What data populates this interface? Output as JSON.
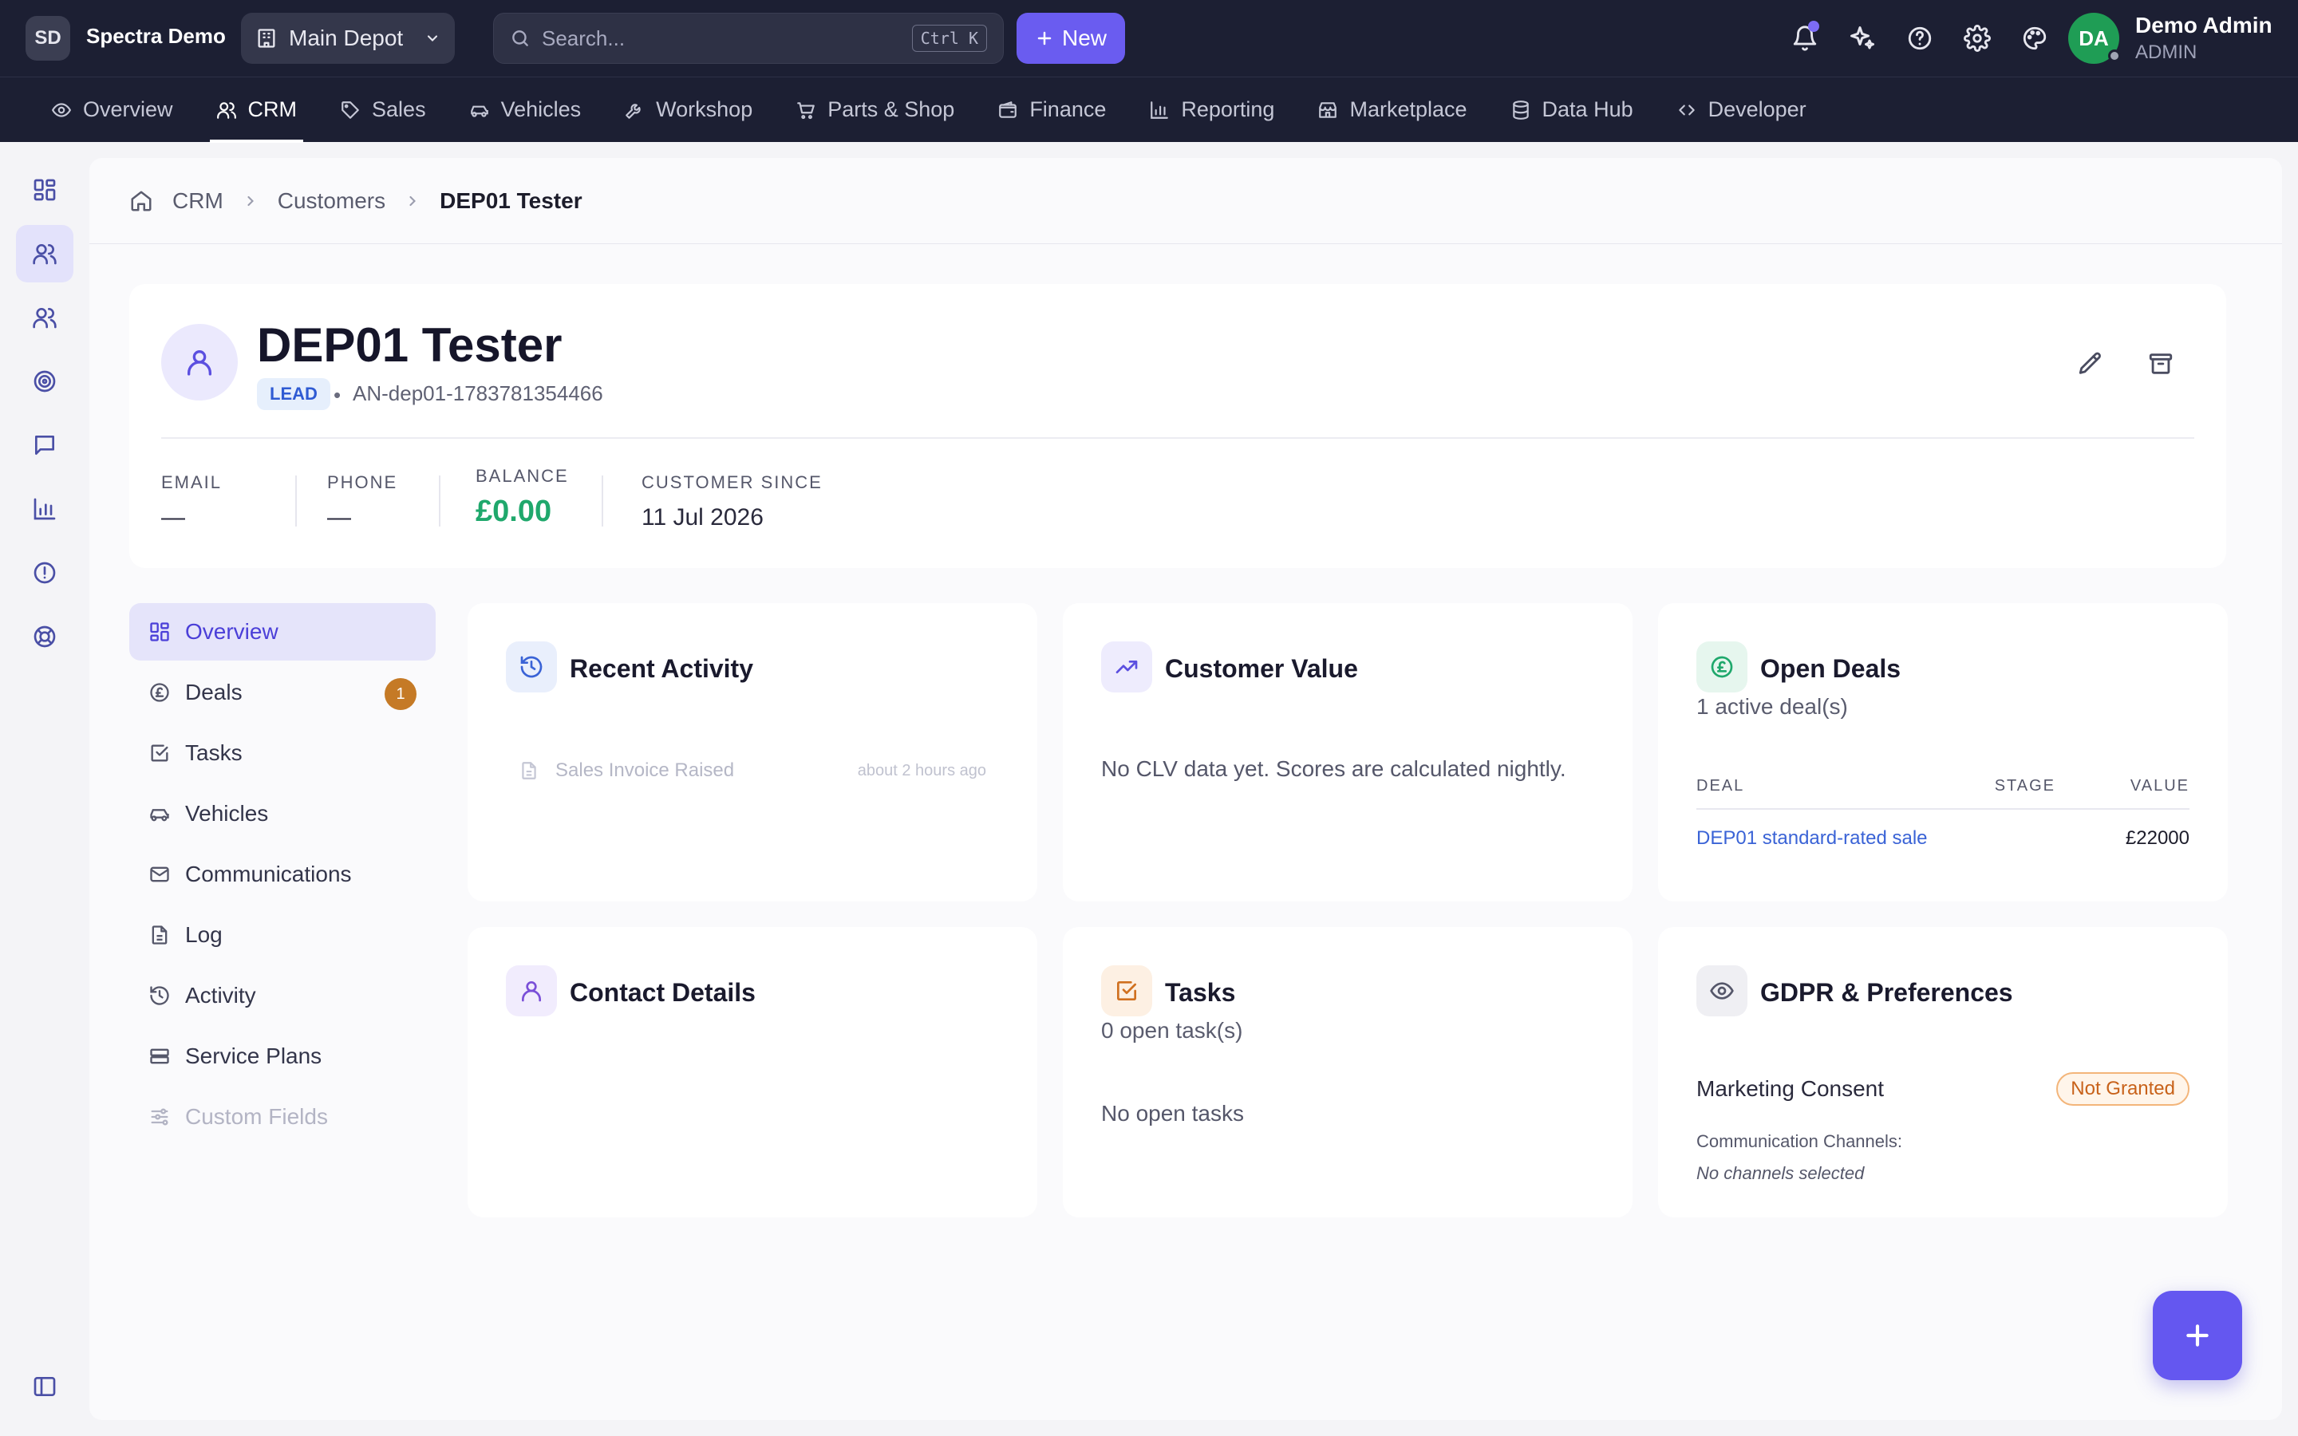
{
  "header": {
    "org_initials": "SD",
    "org_name": "Spectra Demo",
    "depot": "Main Depot",
    "search_placeholder": "Search...",
    "search_shortcut": "Ctrl K",
    "new_label": "New",
    "user_initials": "DA",
    "user_name": "Demo Admin",
    "user_role": "ADMIN"
  },
  "nav": [
    {
      "label": "Overview",
      "icon": "eye-icon"
    },
    {
      "label": "CRM",
      "icon": "users-icon"
    },
    {
      "label": "Sales",
      "icon": "tag-icon"
    },
    {
      "label": "Vehicles",
      "icon": "car-icon"
    },
    {
      "label": "Workshop",
      "icon": "wrench-icon"
    },
    {
      "label": "Parts & Shop",
      "icon": "cart-icon"
    },
    {
      "label": "Finance",
      "icon": "wallet-icon"
    },
    {
      "label": "Reporting",
      "icon": "bar-chart-icon"
    },
    {
      "label": "Marketplace",
      "icon": "store-icon"
    },
    {
      "label": "Data Hub",
      "icon": "database-icon"
    },
    {
      "label": "Developer",
      "icon": "code-icon"
    }
  ],
  "breadcrumb": {
    "root": "CRM",
    "section": "Customers",
    "current": "DEP01 Tester"
  },
  "customer": {
    "name": "DEP01 Tester",
    "status": "LEAD",
    "separator": "•",
    "account_number": "AN-dep01-1783781354466",
    "email_label": "EMAIL",
    "email_value": "—",
    "phone_label": "PHONE",
    "phone_value": "—",
    "balance_label": "BALANCE",
    "balance_value": "£0.00",
    "since_label": "CUSTOMER SINCE",
    "since_value": "11 Jul 2026"
  },
  "tabs": [
    {
      "label": "Overview",
      "icon": "grid-icon"
    },
    {
      "label": "Deals",
      "icon": "pound-icon",
      "count": "1"
    },
    {
      "label": "Tasks",
      "icon": "check-square-icon"
    },
    {
      "label": "Vehicles",
      "icon": "car-icon"
    },
    {
      "label": "Communications",
      "icon": "mail-icon"
    },
    {
      "label": "Log",
      "icon": "file-icon"
    },
    {
      "label": "Activity",
      "icon": "history-icon"
    },
    {
      "label": "Service Plans",
      "icon": "service-icon"
    },
    {
      "label": "Custom Fields",
      "icon": "sliders-icon"
    }
  ],
  "cards": {
    "recent_activity": {
      "title": "Recent Activity",
      "item_label": "Sales Invoice Raised",
      "item_time": "about 2 hours ago"
    },
    "customer_value": {
      "title": "Customer Value",
      "empty_text": "No CLV data yet. Scores are calculated nightly."
    },
    "open_deals": {
      "title": "Open Deals",
      "subtitle": "1 active deal(s)",
      "col_deal": "DEAL",
      "col_stage": "STAGE",
      "col_value": "VALUE",
      "rows": [
        {
          "deal": "DEP01 standard-rated sale",
          "stage": "",
          "value": "£22000"
        }
      ]
    },
    "contact_details": {
      "title": "Contact Details"
    },
    "tasks": {
      "title": "Tasks",
      "subtitle": "0 open task(s)",
      "empty_text": "No open tasks"
    },
    "gdpr": {
      "title": "GDPR & Preferences",
      "consent_label": "Marketing Consent",
      "consent_status": "Not Granted",
      "channels_label": "Communication Channels:",
      "channels_value": "No channels selected"
    }
  },
  "colors": {
    "topbar": "#1c1f33",
    "accent": "#6a5cf0",
    "balance": "#1fa86c",
    "lead_badge": "#2f5bd3",
    "deal_count": "#c57a26",
    "consent_warning": "#c8621a"
  }
}
